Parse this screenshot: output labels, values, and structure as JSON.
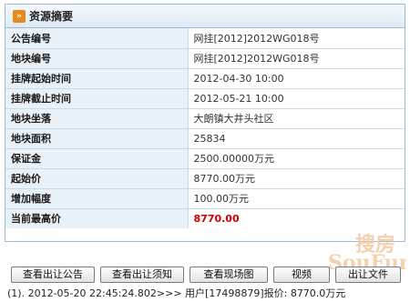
{
  "panel": {
    "title": "资源摘要",
    "rows": [
      {
        "label": "公告编号",
        "value": "网挂[2012]2012WG018号"
      },
      {
        "label": "地块编号",
        "value": "网挂[2012]2012WG018号"
      },
      {
        "label": "挂牌起始时间",
        "value": "2012-04-30 10:00"
      },
      {
        "label": "挂牌截止时间",
        "value": "2012-05-21 10:00"
      },
      {
        "label": "地块坐落",
        "value": "大朗镇大井头社区"
      },
      {
        "label": "地块面积",
        "value": "25834"
      },
      {
        "label": "保证金",
        "value": "2500.00000万元"
      },
      {
        "label": "起始价",
        "value": "8770.00万元"
      },
      {
        "label": "增加幅度",
        "value": "100.00万元"
      },
      {
        "label": "当前最高价",
        "value": "8770.00"
      }
    ],
    "highlight_color": "#cc0000"
  },
  "buttons": {
    "announcement": "查看出让公告",
    "notice": "查看出让须知",
    "site_map": "查看现场图",
    "video": "视频",
    "document": "出让文件"
  },
  "bid_log": {
    "line": "(1). 2012-05-20 22:45:24.802>>> 用户[17498879]报价: 8770.0万元"
  },
  "watermark": {
    "text_cn": "搜房",
    "text_en": "SouFun",
    "url": "www.SouFun.com"
  },
  "colors": {
    "border": "#9bbbd6",
    "label_bg": "#e8f0f8",
    "accent": "#e58a1f"
  }
}
